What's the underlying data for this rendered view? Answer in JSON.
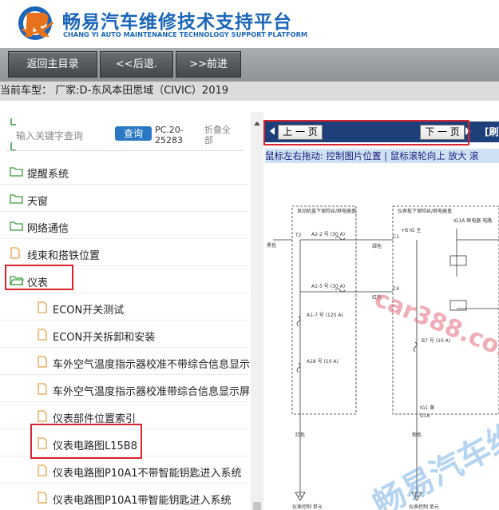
{
  "header": {
    "title": "畅易汽车维修技术支持平台",
    "subtitle": "CHANG YI AUTO MAINTENANCE TECHNOLOGY SUPPORT PLATFORM"
  },
  "nav": {
    "home": "返回主目录",
    "back": "<<后退.",
    "forward": ">>前进"
  },
  "car": {
    "label": "当前车型：  厂家:D-东风本田思域（CIVIC）2019"
  },
  "search": {
    "placeholder": "输入关键字查询",
    "button": "查询",
    "code": "PC.20-25283",
    "collapse": "折叠全部"
  },
  "tree": [
    {
      "label": "提醒系统",
      "type": "folder"
    },
    {
      "label": "天窗",
      "type": "folder"
    },
    {
      "label": "网络通信",
      "type": "folder"
    },
    {
      "label": "线束和搭铁位置",
      "type": "doc"
    },
    {
      "label": "仪表",
      "type": "folder-open"
    },
    {
      "label": "ECON开关测试",
      "type": "doc-child"
    },
    {
      "label": "ECON开关拆卸和安装",
      "type": "doc-child"
    },
    {
      "label": "车外空气温度指示器校准不带综合信息显示",
      "type": "doc-child"
    },
    {
      "label": "车外空气温度指示器校准带综合信息显示屏",
      "type": "doc-child"
    },
    {
      "label": "仪表部件位置索引",
      "type": "doc-child"
    },
    {
      "label": "仪表电路图L15B8",
      "type": "doc-child"
    },
    {
      "label": "仪表电路图P10A1不带智能钥匙进入系统",
      "type": "doc-child"
    },
    {
      "label": "仪表电路图P10A1带智能钥匙进入系统",
      "type": "doc-child"
    }
  ],
  "viewer": {
    "prev": "上 一 页",
    "next": "下 一 页",
    "refresh": "[刷",
    "hint": "鼠标左右拖动: 控制图片位置 | 鼠标滚轮向上 放大  滚"
  },
  "diagram": {
    "labels": {
      "left_box": "发动机盖下保险丝/继电器盒",
      "right_box": "仪表板下保险丝/继电器盒",
      "a2": "A2-2 号 (30 A)",
      "a1": "A1-5 号 (30 A)",
      "a17": "A1-7 号 (125 A)",
      "a18": "A18 号 (10 A)",
      "t2": "T2",
      "black": "黑色",
      "green": "绿色",
      "red": "红色",
      "red2": "红色",
      "pink": "粉色",
      "c1": "C1",
      "c4": "C4",
      "ig": "+B IG 主",
      "ig1a": "IG1A 继电器 电路",
      "b7": "B7 号 (10 A)",
      "ig1": "IG1 黄",
      "g18": "G18",
      "a_mark": "A",
      "b_mark": "B",
      "a_desc": "仪表控制 单元",
      "b_desc": "仪表控制 单元"
    },
    "watermark": "car388.com",
    "watermark2": "畅易汽车维"
  },
  "colors": {
    "brand": "#1b66b8",
    "highlight": "#d9232d",
    "pager": "#1d3f7a"
  }
}
